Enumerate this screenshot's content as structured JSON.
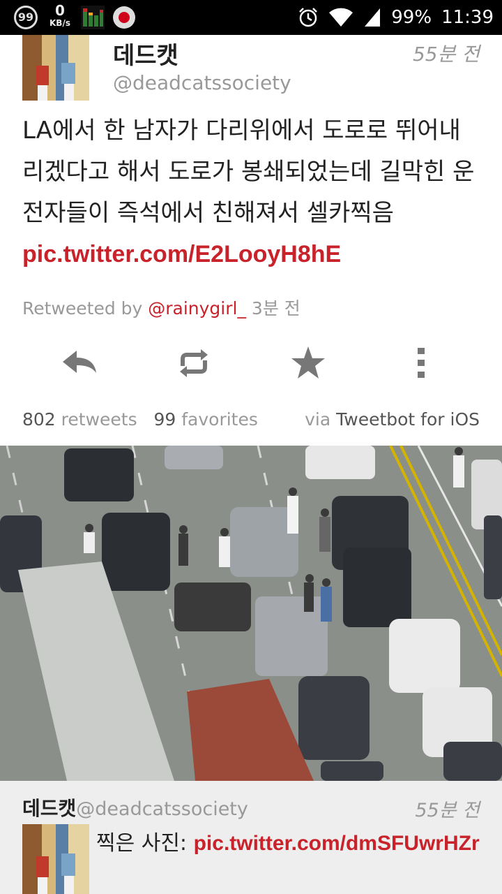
{
  "status_bar": {
    "notification_count": "99",
    "net_speed_value": "0",
    "net_speed_unit": "KB/s",
    "battery": "99%",
    "time": "11:39"
  },
  "tweet": {
    "display_name": "데드캣",
    "handle": "@deadcatssociety",
    "time": "55분 전",
    "text": "LA에서 한 남자가 다리위에서 도로로 뛰어내리겠다고 해서 도로가 봉쇄되었는데 길막힌 운전자들이 즉석에서 친해져서 셀카찍음 ",
    "link": "pic.twitter.com/E2LooyH8hE",
    "retweeted_prefix": "Retweeted by ",
    "retweeted_by": "@rainygirl_",
    "retweeted_time": " 3분 전",
    "retweets_count": "802",
    "retweets_label": " retweets",
    "favorites_count": "99",
    "favorites_label": " favorites",
    "via_label": "via ",
    "client": "Tweetbot for iOS"
  },
  "actions": {
    "reply_icon": "reply-icon",
    "retweet_icon": "retweet-icon",
    "favorite_icon": "star-icon",
    "more_icon": "more-vertical-icon"
  },
  "quoted": {
    "display_name": "데드캣",
    "handle": "@deadcatssociety",
    "time": "55분 전",
    "text": "찍은 사진: ",
    "link": "pic.twitter.com/dmSFUwrHZr"
  },
  "colors": {
    "link": "#c8222b",
    "status_bar": "#000000",
    "quote_bg": "#eeeeee"
  }
}
